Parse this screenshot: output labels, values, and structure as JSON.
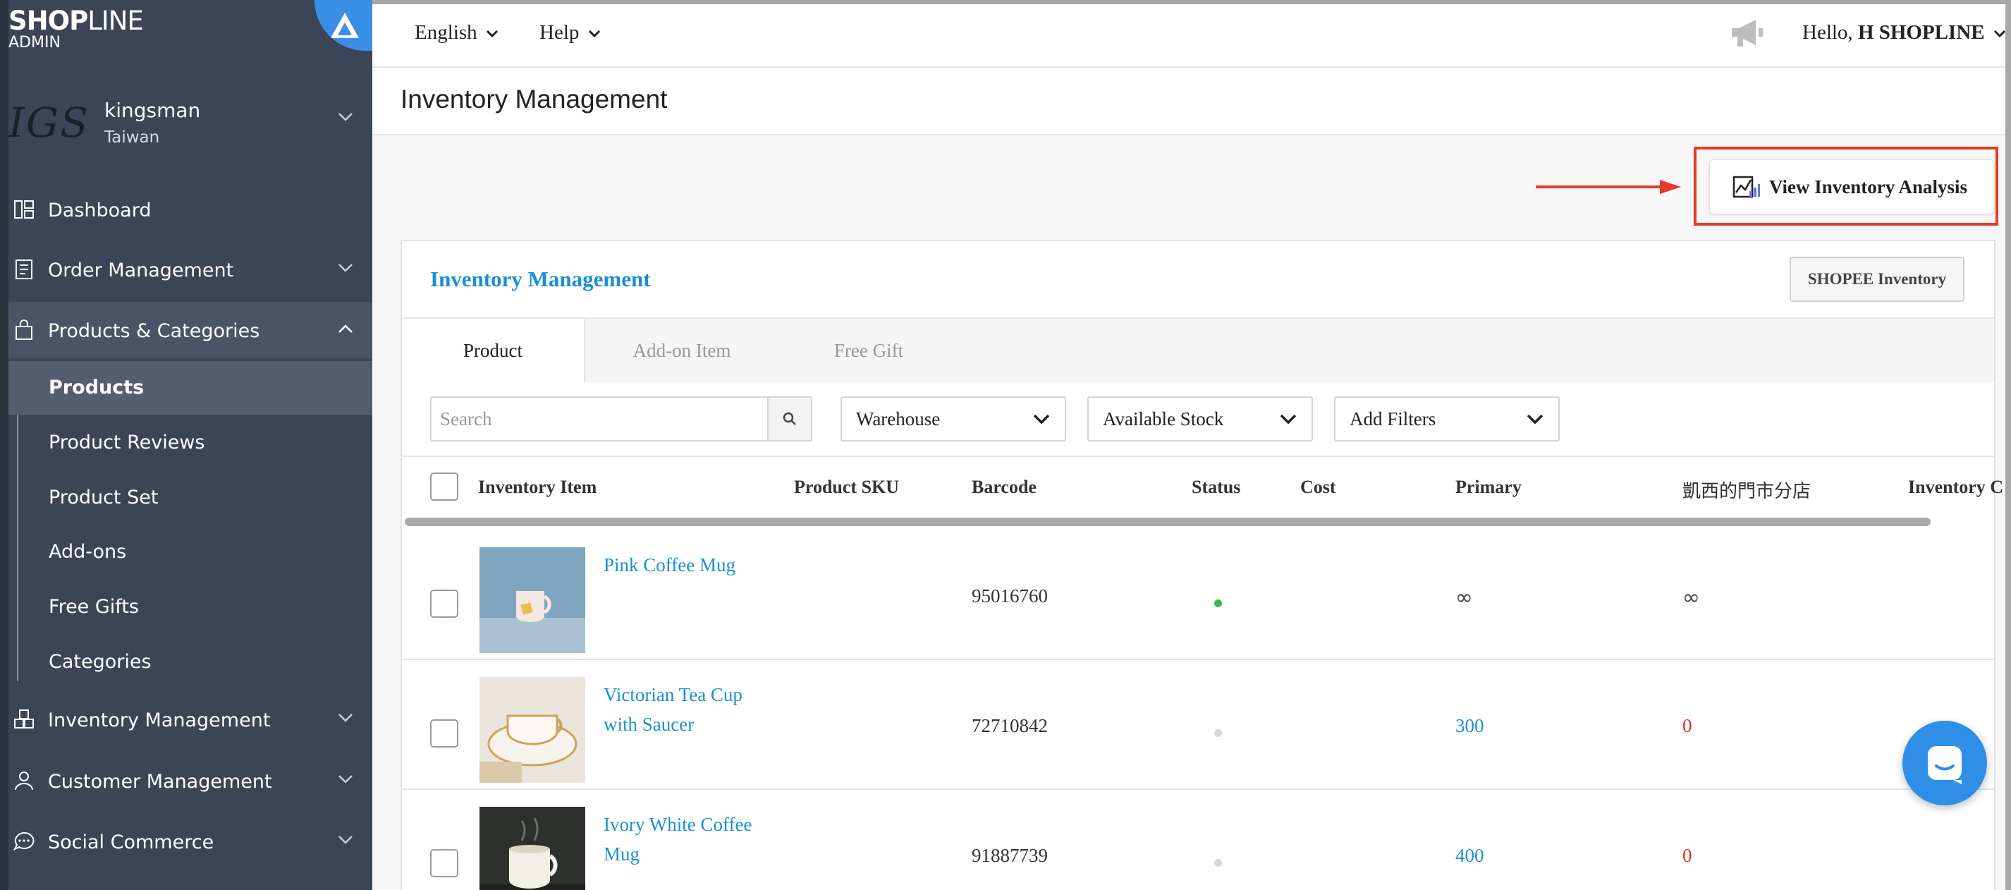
{
  "brand": {
    "logo_bold": "SHOP",
    "logo_thin": "LINE",
    "sub": "ADMIN"
  },
  "store": {
    "logo_text": "IGSM",
    "name": "kingsman",
    "region": "Taiwan"
  },
  "nav": {
    "dashboard": "Dashboard",
    "orders": "Order Management",
    "products": "Products & Categories",
    "inventory": "Inventory Management",
    "customers": "Customer Management",
    "social": "Social Commerce"
  },
  "subnav": [
    "Products",
    "Product Reviews",
    "Product Set",
    "Add-ons",
    "Free Gifts",
    "Categories"
  ],
  "topbar": {
    "language": "English",
    "help": "Help",
    "hello": "Hello,",
    "user": "H SHOPLINE"
  },
  "page": {
    "title": "Inventory Management",
    "analysis_button": "View Inventory Analysis"
  },
  "card": {
    "title": "Inventory Management",
    "shopee_button": "SHOPEE Inventory",
    "tabs": [
      "Product",
      "Add-on Item",
      "Free Gift"
    ],
    "search_placeholder": "Search",
    "filters": [
      "Warehouse",
      "Available Stock",
      "Add Filters"
    ],
    "columns": [
      "Inventory Item",
      "Product SKU",
      "Barcode",
      "Status",
      "Cost",
      "Primary",
      "凱西的門市分店",
      "Inventory C"
    ]
  },
  "rows": [
    {
      "name": "Pink Coffee Mug",
      "barcode": "95016760",
      "status": "active",
      "primary": "∞",
      "branch": "∞"
    },
    {
      "name": "Victorian Tea Cup with Saucer",
      "barcode": "72710842",
      "status": "inactive",
      "primary": "300",
      "branch": "0"
    },
    {
      "name": "Ivory White Coffee Mug",
      "barcode": "91887739",
      "status": "inactive",
      "primary": "400",
      "branch": "0"
    }
  ],
  "colors": {
    "sidebar": "#3b4556",
    "accent": "#1b8fd6",
    "highlight": "#e53a2a",
    "active": "#4caf50",
    "negative": "#d9301c"
  }
}
